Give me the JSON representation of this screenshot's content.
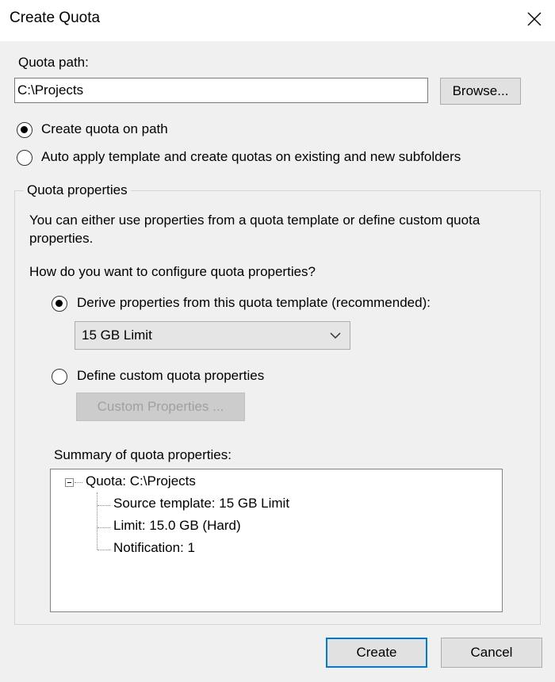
{
  "window": {
    "title": "Create Quota",
    "close_icon": "close-icon"
  },
  "quota_path": {
    "label": "Quota path:",
    "value": "C:\\Projects",
    "browse_label": "Browse..."
  },
  "path_options": [
    {
      "label": "Create quota on path",
      "selected": true
    },
    {
      "label": "Auto apply template and create quotas on existing and new subfolders",
      "selected": false
    }
  ],
  "quota_properties": {
    "group_title": "Quota properties",
    "description": "You can either use properties from a quota template or define custom quota properties.",
    "question": "How do you want to configure quota properties?",
    "options": [
      {
        "label": "Derive properties from this quota template (recommended):",
        "selected": true
      },
      {
        "label": "Define custom quota properties",
        "selected": false
      }
    ],
    "template_select": {
      "value": "15 GB Limit",
      "icon": "chevron-down-icon"
    },
    "custom_properties_label": "Custom Properties ..."
  },
  "summary": {
    "label": "Summary of quota properties:",
    "root": "Quota: C:\\Projects",
    "children": [
      "Source template: 15 GB Limit",
      "Limit: 15.0 GB (Hard)",
      "Notification: 1"
    ]
  },
  "footer": {
    "create_label": "Create",
    "cancel_label": "Cancel"
  }
}
